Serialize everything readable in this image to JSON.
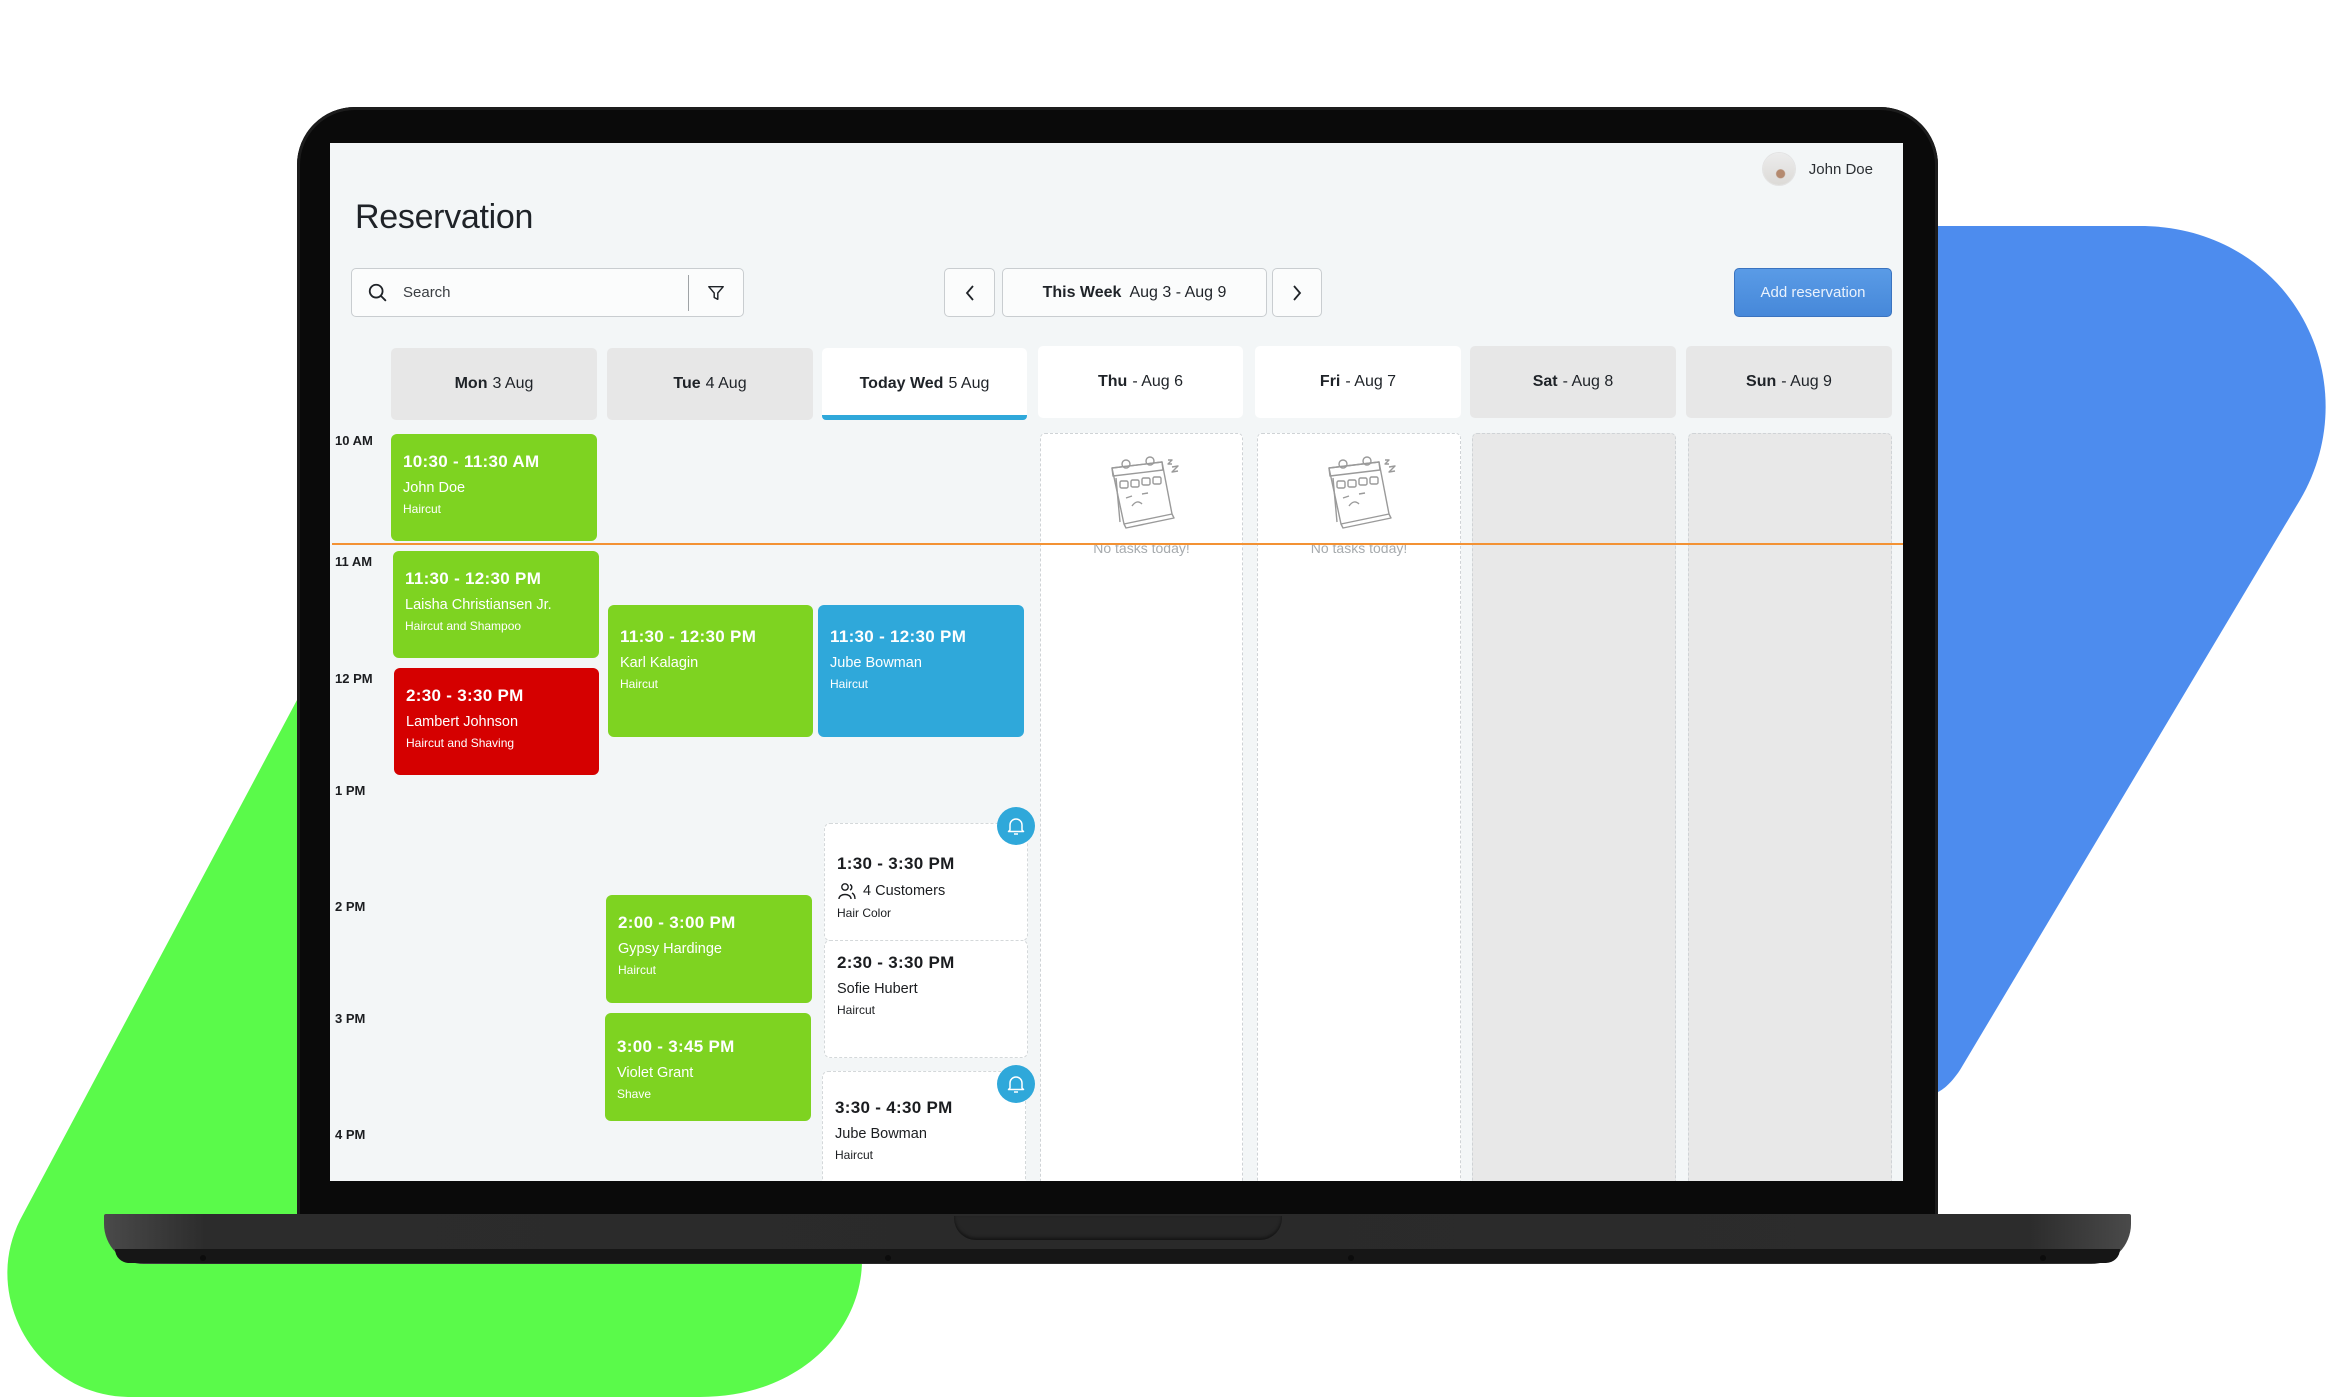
{
  "app": {
    "title": "Reservation",
    "user": {
      "name": "John Doe",
      "avatar_icon": "user-avatar"
    }
  },
  "toolbar": {
    "search_placeholder": "Search",
    "search_value": "",
    "filter_icon": "filter-icon",
    "prev_icon": "chevron-left-icon",
    "next_icon": "chevron-right-icon",
    "week_bold": "This Week",
    "week_range": "Aug 3 - Aug 9",
    "add_label": "Add reservation"
  },
  "days": [
    {
      "bold": "Mon",
      "rest": "3 Aug",
      "style": "grey",
      "today": false
    },
    {
      "bold": "Tue",
      "rest": "4 Aug",
      "style": "grey",
      "today": false
    },
    {
      "bold": "Today Wed",
      "rest": "5 Aug",
      "style": "white",
      "today": true
    },
    {
      "bold": "Thu",
      "rest": "- Aug 6",
      "style": "white",
      "today": false
    },
    {
      "bold": "Fri",
      "rest": "- Aug 7",
      "style": "white",
      "today": false
    },
    {
      "bold": "Sat",
      "rest": "- Aug 8",
      "style": "grey",
      "today": false
    },
    {
      "bold": "Sun",
      "rest": "- Aug 9",
      "style": "grey",
      "today": false
    }
  ],
  "times": [
    "10 AM",
    "11 AM",
    "12 PM",
    "1 PM",
    "2 PM",
    "3 PM",
    "4 PM"
  ],
  "empty_message": "No tasks today!",
  "events": {
    "mon": [
      {
        "time": "10:30 - 11:30 AM",
        "name": "John Doe",
        "service": "Haircut",
        "color": "green"
      },
      {
        "time": "11:30 - 12:30 PM",
        "name": "Laisha Christiansen Jr.",
        "service": "Haircut and Shampoo",
        "color": "green"
      },
      {
        "time": "2:30 - 3:30 PM",
        "name": "Lambert Johnson",
        "service": "Haircut and Shaving",
        "color": "red"
      }
    ],
    "tue": [
      {
        "time": "11:30 - 12:30 PM",
        "name": "Karl Kalagin",
        "service": "Haircut",
        "color": "green"
      },
      {
        "time": "2:00 - 3:00 PM",
        "name": "Gypsy Hardinge",
        "service": "Haircut",
        "color": "green"
      },
      {
        "time": "3:00 - 3:45 PM",
        "name": "Violet Grant",
        "service": "Shave",
        "color": "green"
      }
    ],
    "wed": [
      {
        "time": "11:30 - 12:30 PM",
        "name": "Jube Bowman",
        "service": "Haircut",
        "color": "blue"
      },
      {
        "time": "1:30 - 3:30 PM",
        "customers": "4 Customers",
        "service": "Hair Color",
        "color": "white",
        "notification": true
      },
      {
        "time": "2:30 - 3:30 PM",
        "name": "Sofie Hubert",
        "service": "Haircut",
        "color": "white"
      },
      {
        "time": "3:30 - 4:30 PM",
        "name": "Jube Bowman",
        "service": "Haircut",
        "color": "white",
        "notification": true
      }
    ]
  },
  "colors": {
    "green": "#7ed321",
    "red": "#d50000",
    "blue": "#2fa8da",
    "accent": "#4a8ce0",
    "now_line": "#f39234",
    "bg_green": "#5afa4a",
    "bg_blue": "#4d8cee"
  }
}
